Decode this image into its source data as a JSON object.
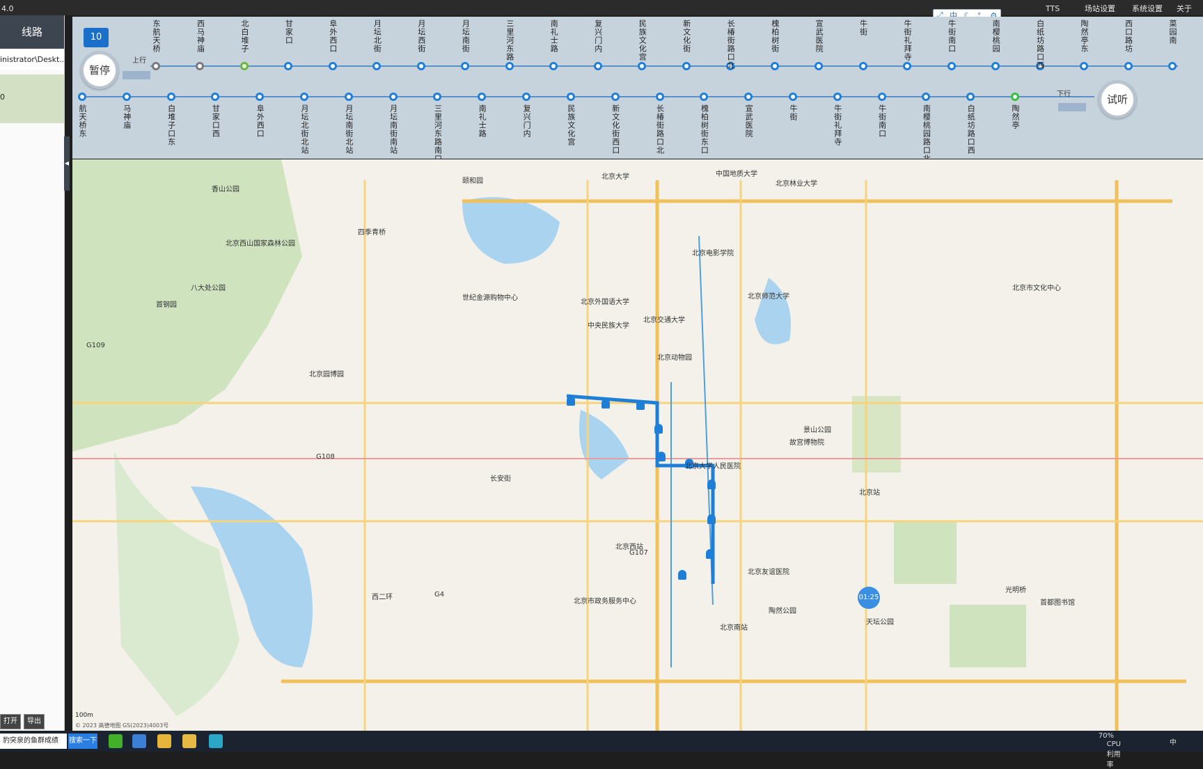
{
  "app": {
    "version_fragment": "4.0"
  },
  "menu": {
    "tts": "TTS",
    "station_settings": "场站设置",
    "system_settings": "系统设置",
    "about": "关于",
    "mini_tool_lang": "中"
  },
  "sidebar": {
    "route_tab": "线路",
    "path_text": "inistrator\\Deskt...",
    "selected_value": "0"
  },
  "controls": {
    "pause": "暂停",
    "listen": "试听",
    "count": "10",
    "up_label": "上行",
    "down_label": "下行"
  },
  "stations_up": [
    "东航天桥",
    "西马神庙",
    "北白堆子",
    "甘家口",
    "阜外西口",
    "月坛北街",
    "月坛西街",
    "月坛南街",
    "三里河东路",
    "南礼士路",
    "复兴门内",
    "民族文化宫",
    "新文化街",
    "长椿街路口北",
    "槐柏树街",
    "宣武医院",
    "牛街",
    "牛街礼拜寺",
    "牛街南口",
    "南樱桃园",
    "白纸坊路口西",
    "陶然亭东",
    "西口路坊",
    "菜园南"
  ],
  "stations_down": [
    "航天桥东",
    "马神庙",
    "白堆子口东",
    "甘家口西",
    "阜外西口",
    "月坛北街北站",
    "月坛南街北站",
    "月坛南街南站",
    "三里河东路南口",
    "南礼士路",
    "复兴门内",
    "民族文化宫",
    "新文化街西口",
    "长椿街路口北",
    "槐柏树街东口",
    "宣武医院",
    "牛街",
    "牛街礼拜寺",
    "牛街南口",
    "南樱桃园路口北",
    "白纸坊路口西",
    "陶然亭"
  ],
  "map": {
    "labels": [
      "北京大学",
      "中国地质大学",
      "北京林业大学",
      "香山公园",
      "颐和园",
      "北京西山国家森林公园",
      "四季青桥",
      "八大处公园",
      "北京外国语大学",
      "北京交通大学",
      "中央民族大学",
      "北京电影学院",
      "北京师范大学",
      "北京动物园",
      "世纪金源购物中心",
      "首钢园",
      "北京园博园",
      "北京市文化中心",
      "北京大学人民医院",
      "北京西站",
      "北京南站",
      "北京站",
      "天坛公园",
      "故宫博物院",
      "景山公园",
      "陶然公园",
      "北京友谊医院",
      "首都图书馆",
      "光明桥",
      "G109",
      "G108",
      "G107",
      "G4",
      "西二环",
      "长安街",
      "北京市政务服务中心"
    ],
    "time_badge": "01:25",
    "scale": "100m",
    "copyright": "© 2023 高德地图 GS(2023)4003号"
  },
  "bottom": {
    "open": "打开",
    "export": "导出"
  },
  "taskbar": {
    "search_text": "豹突泉的鱼群成绩",
    "search_button": "搜索一下",
    "cpu": "70%",
    "cpu_label": "CPU利用率",
    "ime": "中"
  }
}
